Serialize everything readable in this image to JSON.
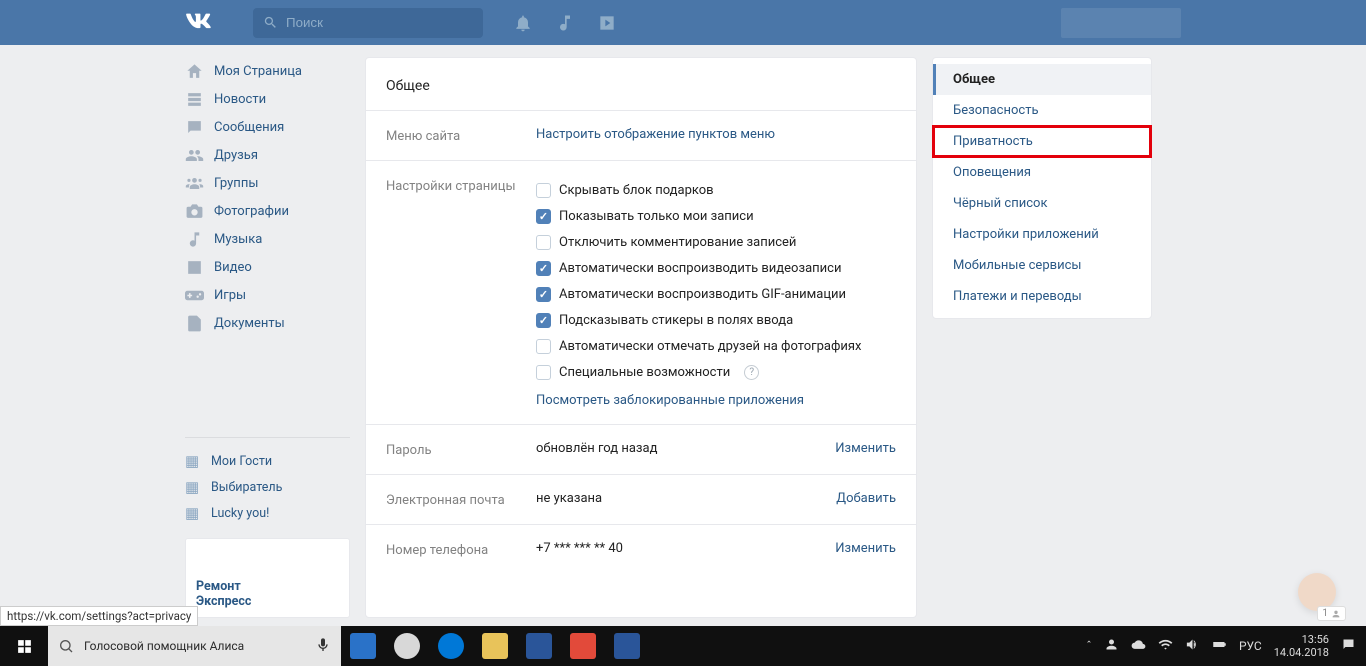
{
  "topbar": {
    "search_placeholder": "Поиск"
  },
  "leftnav": {
    "items": [
      {
        "id": "home",
        "label": "Моя Страница"
      },
      {
        "id": "news",
        "label": "Новости"
      },
      {
        "id": "messages",
        "label": "Сообщения"
      },
      {
        "id": "friends",
        "label": "Друзья"
      },
      {
        "id": "groups",
        "label": "Группы"
      },
      {
        "id": "photos",
        "label": "Фотографии"
      },
      {
        "id": "music",
        "label": "Музыка"
      },
      {
        "id": "video",
        "label": "Видео"
      },
      {
        "id": "games",
        "label": "Игры"
      },
      {
        "id": "docs",
        "label": "Документы"
      }
    ],
    "apps": [
      {
        "id": "guests",
        "label": "Мои Гости"
      },
      {
        "id": "vibiratel",
        "label": "Выбиратель"
      },
      {
        "id": "lucky",
        "label": "Lucky you!"
      }
    ],
    "ad": "Ремонт\nЭкспресс"
  },
  "settings": {
    "title": "Общее",
    "menu": {
      "label": "Меню сайта",
      "link": "Настроить отображение пунктов меню"
    },
    "page": {
      "label": "Настройки страницы",
      "checks": [
        {
          "checked": false,
          "text": "Скрывать блок подарков"
        },
        {
          "checked": true,
          "text": "Показывать только мои записи"
        },
        {
          "checked": false,
          "text": "Отключить комментирование записей"
        },
        {
          "checked": true,
          "text": "Автоматически воспроизводить видеозаписи"
        },
        {
          "checked": true,
          "text": "Автоматически воспроизводить GIF-анимации"
        },
        {
          "checked": true,
          "text": "Подсказывать стикеры в полях ввода"
        },
        {
          "checked": false,
          "text": "Автоматически отмечать друзей на фотографиях"
        },
        {
          "checked": false,
          "text": "Специальные возможности",
          "help": true
        }
      ],
      "blocked_link": "Посмотреть заблокированные приложения"
    },
    "password": {
      "label": "Пароль",
      "value": "обновлён год назад",
      "action": "Изменить"
    },
    "email": {
      "label": "Электронная почта",
      "value": "не указана",
      "action": "Добавить"
    },
    "phone": {
      "label": "Номер телефона",
      "value": "+7 *** *** ** 40",
      "action": "Изменить"
    }
  },
  "rightnav": {
    "items": [
      {
        "id": "general",
        "label": "Общее",
        "active": true
      },
      {
        "id": "security",
        "label": "Безопасность"
      },
      {
        "id": "privacy",
        "label": "Приватность",
        "highlight": true
      },
      {
        "id": "notifications",
        "label": "Оповещения"
      },
      {
        "id": "blacklist",
        "label": "Чёрный список"
      },
      {
        "id": "apps",
        "label": "Настройки приложений"
      },
      {
        "id": "mobile",
        "label": "Мобильные сервисы"
      },
      {
        "id": "payments",
        "label": "Платежи и переводы"
      }
    ]
  },
  "status_url": "https://vk.com/settings?act=privacy",
  "taskbar": {
    "search": "Голосовой помощник Алиса",
    "lang": "РУС",
    "time": "13:56",
    "date": "14.04.2018"
  },
  "chat_count": "1"
}
